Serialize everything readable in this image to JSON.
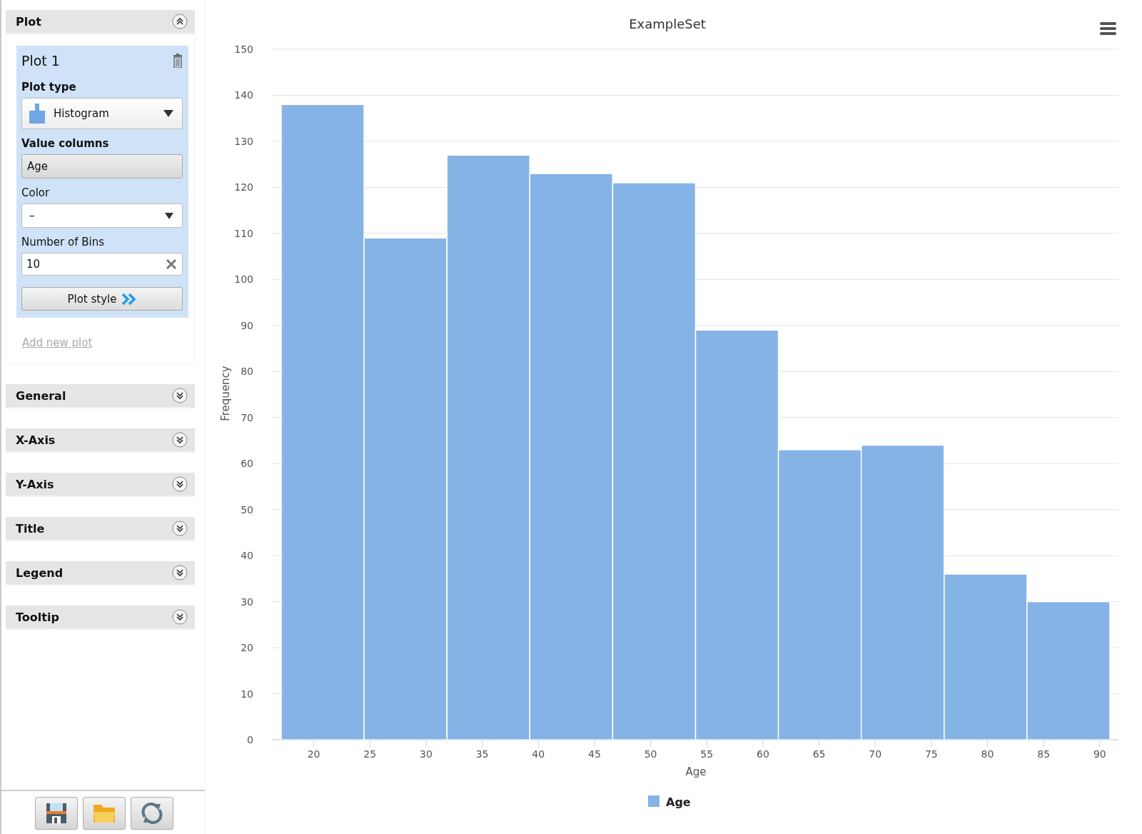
{
  "plot_section": {
    "title": "Plot",
    "expanded": true,
    "plots": [
      {
        "title": "Plot 1",
        "plot_type_label": "Plot type",
        "plot_type": "Histogram",
        "value_columns_label": "Value columns",
        "value_column": "Age",
        "color_label": "Color",
        "color_value": "–",
        "bins_label": "Number of Bins",
        "bins_value": "10",
        "style_button": "Plot style"
      }
    ],
    "add_link": "Add new plot"
  },
  "sections": [
    {
      "title": "General",
      "expanded": false
    },
    {
      "title": "X-Axis",
      "expanded": false
    },
    {
      "title": "Y-Axis",
      "expanded": false
    },
    {
      "title": "Title",
      "expanded": false
    },
    {
      "title": "Legend",
      "expanded": false
    },
    {
      "title": "Tooltip",
      "expanded": false
    }
  ],
  "chart": {
    "chart_data": {
      "type": "bar",
      "title": "ExampleSet",
      "xlabel": "Age",
      "ylabel": "Frequency",
      "x": [
        20.79,
        28.17,
        35.55,
        42.93,
        50.31,
        57.69,
        65.07,
        72.45,
        79.83,
        87.21
      ],
      "series": [
        {
          "name": "Age",
          "color": "#86b3e6",
          "values": [
            138,
            109,
            127,
            123,
            121,
            89,
            63,
            64,
            36,
            30
          ]
        }
      ],
      "xlim": [
        17.1,
        90.9
      ],
      "ylim": [
        0,
        150
      ],
      "xticks": [
        20,
        25,
        30,
        35,
        40,
        45,
        50,
        55,
        60,
        65,
        70,
        75,
        80,
        85,
        90
      ],
      "yticks": [
        0,
        10,
        20,
        30,
        40,
        50,
        60,
        70,
        80,
        90,
        100,
        110,
        120,
        130,
        140,
        150
      ],
      "grid": true
    }
  }
}
